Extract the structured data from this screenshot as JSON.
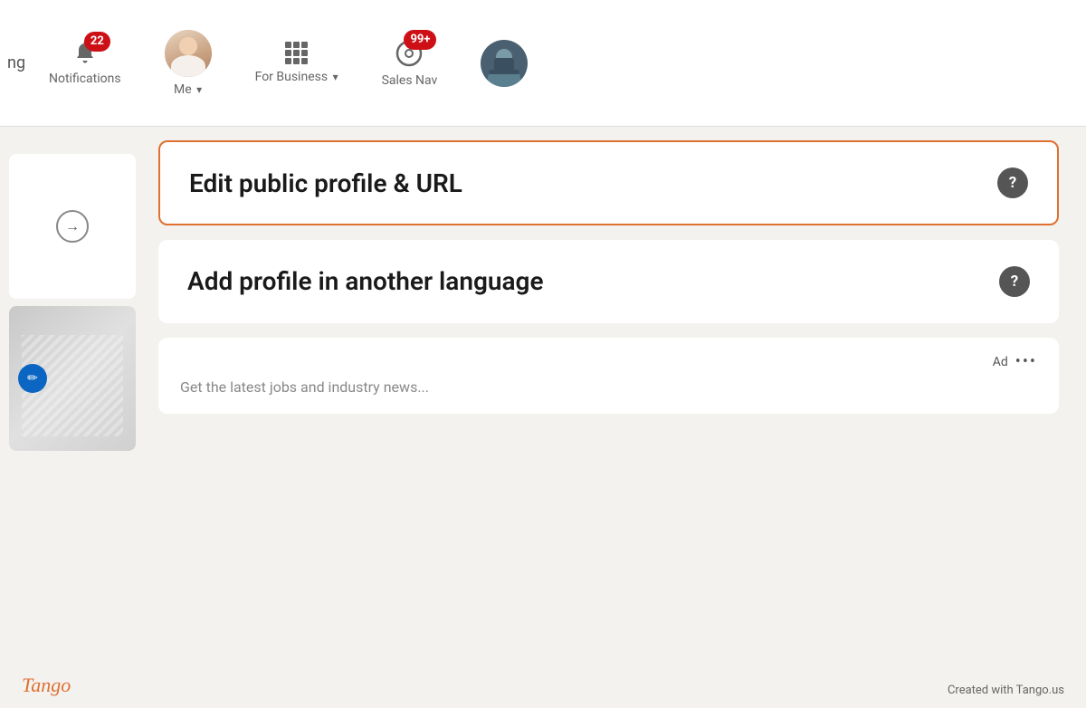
{
  "navbar": {
    "partial_text": "ng",
    "notifications": {
      "label": "Notifications",
      "badge": "22"
    },
    "me": {
      "label": "Me",
      "has_chevron": true
    },
    "for_business": {
      "label": "For Business",
      "has_chevron": true
    },
    "sales_nav": {
      "label": "Sales Nav",
      "badge": "99+"
    }
  },
  "cards": {
    "edit_profile": {
      "title": "Edit public profile & URL",
      "highlighted": true
    },
    "add_language": {
      "title": "Add profile in another language"
    },
    "ad": {
      "label": "Ad",
      "partial_text": "Get the latest jobs and industry news..."
    }
  },
  "footer": {
    "tango_label": "Tango",
    "created_label": "Created with Tango.us"
  }
}
